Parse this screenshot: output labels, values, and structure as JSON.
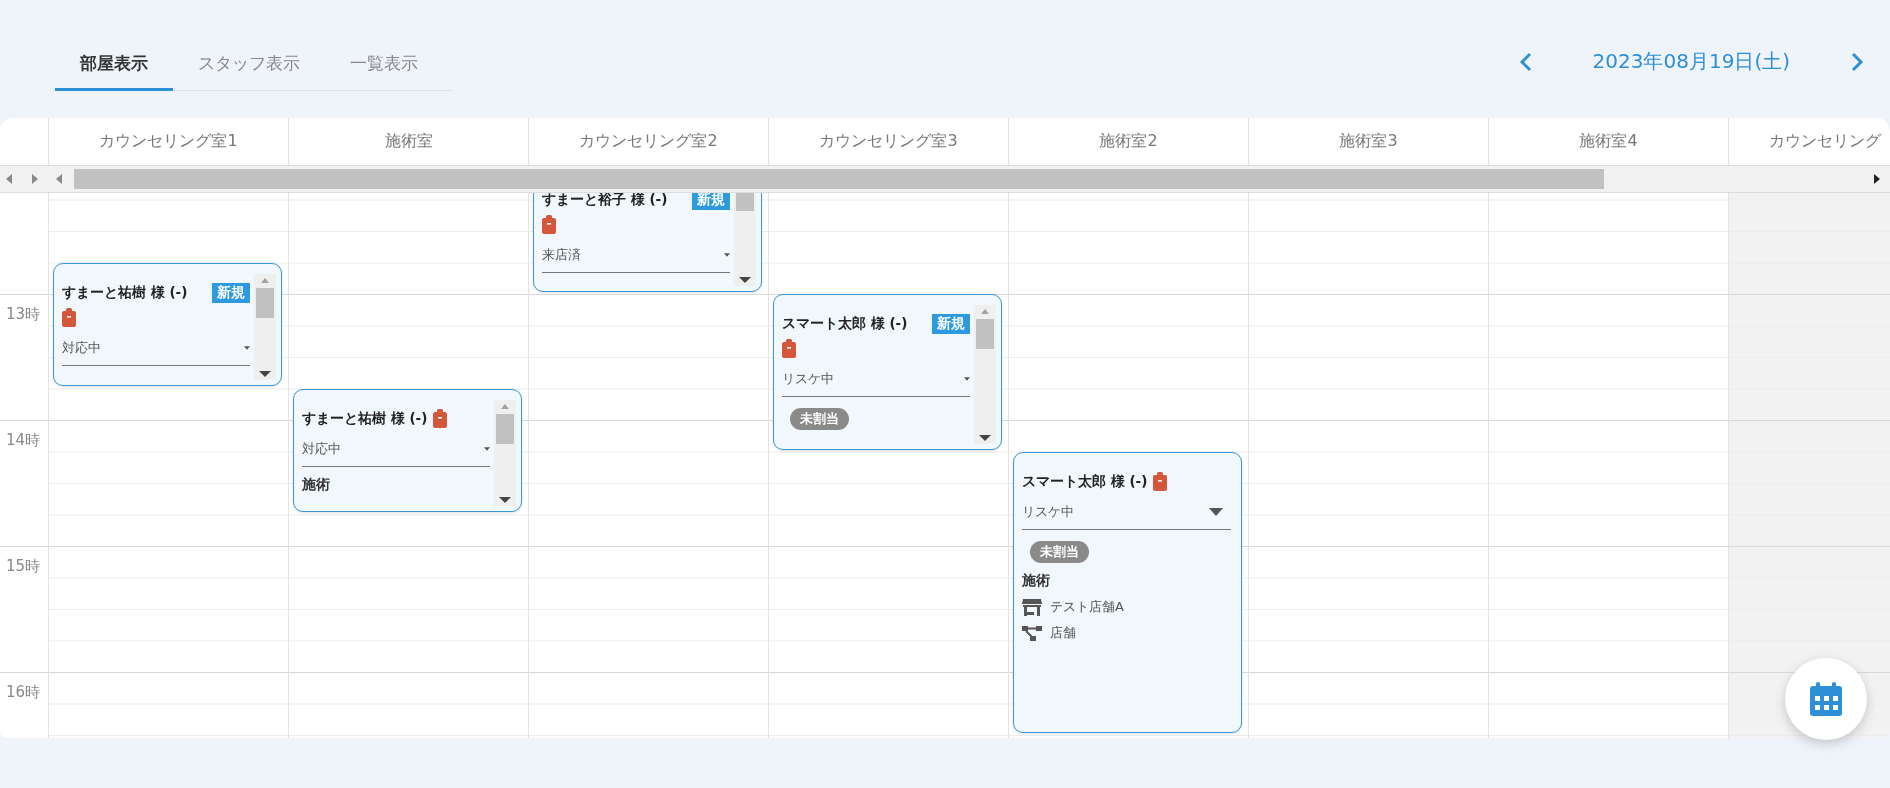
{
  "tabs": [
    {
      "label": "部屋表示",
      "selected": true
    },
    {
      "label": "スタッフ表示",
      "selected": false
    },
    {
      "label": "一覧表示",
      "selected": false
    }
  ],
  "date_nav": {
    "date": "2023年08月19日(土)"
  },
  "hours": [
    "13時",
    "14時",
    "15時",
    "16時"
  ],
  "rooms": [
    {
      "name": "カウンセリング室1",
      "disabled": false,
      "appointments": [
        {
          "name": "すまーと祐樹 様 (-)",
          "badge": "新規",
          "status": "対応中"
        }
      ]
    },
    {
      "name": "施術室",
      "disabled": false,
      "appointments": [
        {
          "name": "すまーと祐樹 様 (-)",
          "status": "対応中",
          "menu": "施術"
        }
      ]
    },
    {
      "name": "カウンセリング室2",
      "disabled": false,
      "appointments": [
        {
          "name": "すまーと裕子 様 (-)",
          "badge": "新規",
          "status": "来店済"
        }
      ]
    },
    {
      "name": "カウンセリング室3",
      "disabled": false,
      "appointments": [
        {
          "name": "スマート太郎 様 (-)",
          "badge": "新規",
          "status": "リスケ中",
          "assignment": "未割当"
        }
      ]
    },
    {
      "name": "施術室2",
      "disabled": false,
      "appointments": [
        {
          "name": "スマート太郎 様 (-)",
          "status": "リスケ中",
          "assignment": "未割当",
          "menu": "施術",
          "store": "テスト店舗A",
          "category": "店舗"
        }
      ]
    },
    {
      "name": "施術室3",
      "disabled": false
    },
    {
      "name": "施術室4",
      "disabled": false
    },
    {
      "name": "カウンセリング",
      "disabled": true
    }
  ]
}
